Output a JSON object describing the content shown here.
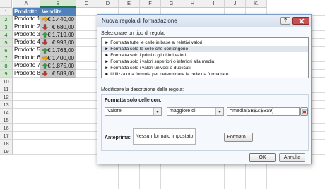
{
  "sheet": {
    "columns": [
      "A",
      "B",
      "C",
      "D",
      "E",
      "F",
      "G",
      "H",
      "I",
      "J",
      "K"
    ],
    "rows": [
      "1",
      "2",
      "3",
      "4",
      "5",
      "6",
      "7",
      "8",
      "9",
      "10",
      "11",
      "12",
      "13",
      "14",
      "15",
      "16",
      "17",
      "18",
      "19"
    ],
    "header_a": "Prodotto",
    "header_b": "Vendite",
    "data": [
      {
        "name": "Prodotto 1",
        "value": "€ 1.440,00",
        "arrow": "right"
      },
      {
        "name": "Prodotto 2",
        "value": "€ 680,00",
        "arrow": "down"
      },
      {
        "name": "Prodotto 3",
        "value": "€ 1.719,00",
        "arrow": "up"
      },
      {
        "name": "Prodotto 4",
        "value": "€ 993,00",
        "arrow": "down"
      },
      {
        "name": "Prodotto 5",
        "value": "€ 1.763,00",
        "arrow": "up"
      },
      {
        "name": "Prodotto 6",
        "value": "€ 1.400,00",
        "arrow": "right"
      },
      {
        "name": "Prodotto 7",
        "value": "€ 1.875,00",
        "arrow": "up"
      },
      {
        "name": "Prodotto 8",
        "value": "€ 589,00",
        "arrow": "down"
      }
    ],
    "colors": {
      "up": "#3aa142",
      "down": "#c0392b",
      "right": "#f0a500",
      "header_fill": "#4f81bd"
    }
  },
  "dialog": {
    "title": "Nuova regola di formattazione",
    "help": "?",
    "select_label": "Selezionare un tipo di regola:",
    "rule_types": [
      "► Formatta tutte le celle in base ai relativi valori",
      "► Formatta solo le celle che contengono",
      "► Formatta solo i primi o gli ultimi valori",
      "► Formatta solo i valori superiori o inferiori alla media",
      "► Formatta solo i valori univoci o duplicati",
      "► Utilizza una formula per determinare le celle da formattare"
    ],
    "selected_rule_index": 1,
    "edit_label": "Modificare la descrizione della regola:",
    "format_only_label": "Formatta solo celle con:",
    "cond_type": "Valore",
    "operator": "maggiore di",
    "formula": "=media($B$2:$B$9)",
    "preview_label": "Anteprima:",
    "preview_text": "Nessun formato impostato",
    "format_button": "Formato...",
    "ok_button": "OK",
    "cancel_button": "Annulla"
  }
}
